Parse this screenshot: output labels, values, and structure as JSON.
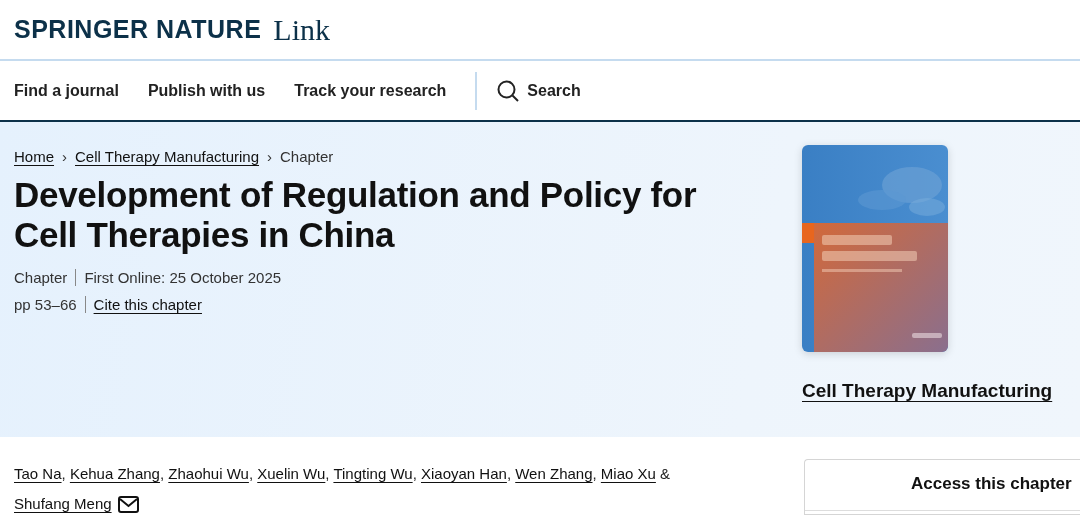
{
  "logo": {
    "brand": "SPRINGER NATURE",
    "product": "Link"
  },
  "nav": {
    "items": [
      "Find a journal",
      "Publish with us",
      "Track your research"
    ],
    "search": "Search"
  },
  "breadcrumbs": [
    {
      "label": "Home",
      "link": true,
      "separator": "›"
    },
    {
      "label": "Cell Therapy Manufacturing",
      "link": true,
      "separator": "›"
    },
    {
      "label": "Chapter",
      "link": false
    }
  ],
  "title": "Development of Regulation and Policy for Cell Therapies in China",
  "meta": {
    "type": "Chapter",
    "first_online": "First Online: 25 October 2025",
    "pages": "pp 53–66",
    "cite": "Cite this chapter"
  },
  "book": {
    "title": "Cell Therapy Manufacturing"
  },
  "authors": [
    {
      "name": "Tao Na",
      "contact": false,
      "separator": ","
    },
    {
      "name": "Kehua Zhang",
      "contact": false,
      "separator": ","
    },
    {
      "name": "Zhaohui Wu",
      "contact": false,
      "separator": ","
    },
    {
      "name": "Xuelin Wu",
      "contact": false,
      "separator": ","
    },
    {
      "name": "Tingting Wu",
      "contact": false,
      "separator": ","
    },
    {
      "name": "Xiaoyan Han",
      "contact": false,
      "separator": ","
    },
    {
      "name": "Wen Zhang",
      "contact": false,
      "separator": ","
    },
    {
      "name": "Miao Xu",
      "contact": false,
      "separator": "&"
    },
    {
      "name": "Shufang Meng",
      "contact": true
    }
  ],
  "access": {
    "title": "Access this chapter"
  }
}
